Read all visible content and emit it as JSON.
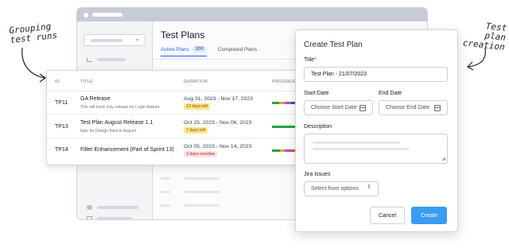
{
  "annotations": {
    "left": [
      "Grouping",
      "test runs"
    ],
    "right": [
      "Test plan",
      "creation"
    ]
  },
  "page": {
    "title": "Test Plans",
    "tabs": [
      {
        "label": "Active Plans",
        "count": "200"
      },
      {
        "label": "Completed Plans"
      }
    ]
  },
  "table": {
    "headers": [
      "ID",
      "TITLE",
      "DURATION",
      "PROGRESS"
    ],
    "rows": [
      {
        "id": "TP11",
        "title": "GA Release",
        "desc": "This will track July release for Login feature",
        "duration": "Aug 31, 2023  - Nov 17, 2023",
        "badge": "13 days left",
        "badge_kind": "warn"
      },
      {
        "id": "TP13",
        "title": "Test Plan August Release 1.1",
        "desc": "Epic for Design fixes in August",
        "duration": "Oct 25, 2023 - Nov 06, 2023",
        "badge": "7 days left",
        "badge_kind": "warn"
      },
      {
        "id": "TP14",
        "title": "Filter Enhancement (Part of Sprint 13)",
        "desc": "",
        "duration": "Oct 05, 2023  - Nov 14, 2023",
        "badge": "3 days overdue",
        "badge_kind": "danger"
      }
    ]
  },
  "modal": {
    "title": "Create Test Plan",
    "title_label": "Title",
    "title_value": "Test Plan - 21/07/2023",
    "start_label": "Start Date",
    "start_placeholder": "Choose Start Date",
    "end_label": "End Date",
    "end_placeholder": "Choose End Date",
    "desc_label": "Description",
    "jira_label": "Jira Issues",
    "jira_placeholder": "Select from options",
    "cancel": "Cancel",
    "create": "Create"
  },
  "colors": {
    "accent": "#3b9cf0",
    "tab_active": "#2563eb",
    "warn_badge": "#fde68a",
    "danger_badge": "#fde2e2"
  }
}
